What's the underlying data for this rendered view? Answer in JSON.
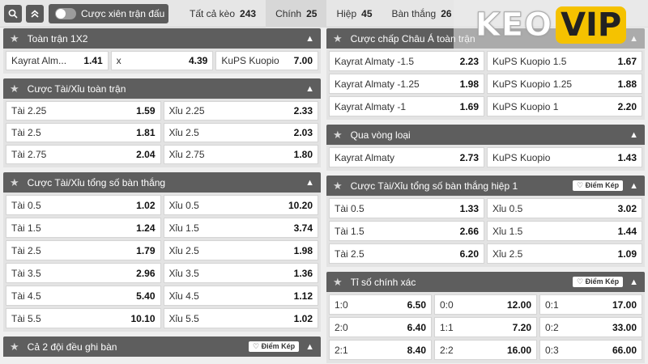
{
  "topbar": {
    "search_icon": "search-icon",
    "collapse_icon": "double-chevron-up-icon",
    "toggle_label": "Cược xiên trận đấu",
    "tabs": [
      {
        "label": "Tất cả kèo",
        "count": "243"
      },
      {
        "label": "Chính",
        "count": "25"
      },
      {
        "label": "Hiệp",
        "count": "45"
      },
      {
        "label": "Bàn thắng",
        "count": "26"
      }
    ]
  },
  "logo": {
    "part1": "KEO",
    "part2": "VIP"
  },
  "left": {
    "p1": {
      "title": "Toàn trận 1X2",
      "rows": [
        [
          [
            "Kayrat Alm...",
            "1.41"
          ],
          [
            "x",
            "4.39"
          ],
          [
            "KuPS Kuopio",
            "7.00"
          ]
        ]
      ]
    },
    "p2": {
      "title": "Cược Tài/Xỉu toàn trận",
      "rows": [
        [
          [
            "Tài 2.25",
            "1.59"
          ],
          [
            "Xỉu 2.25",
            "2.33"
          ]
        ],
        [
          [
            "Tài 2.5",
            "1.81"
          ],
          [
            "Xỉu 2.5",
            "2.03"
          ]
        ],
        [
          [
            "Tài 2.75",
            "2.04"
          ],
          [
            "Xỉu 2.75",
            "1.80"
          ]
        ]
      ]
    },
    "p3": {
      "title": "Cược Tài/Xỉu tổng số bàn thắng",
      "rows": [
        [
          [
            "Tài 0.5",
            "1.02"
          ],
          [
            "Xỉu 0.5",
            "10.20"
          ]
        ],
        [
          [
            "Tài 1.5",
            "1.24"
          ],
          [
            "Xỉu 1.5",
            "3.74"
          ]
        ],
        [
          [
            "Tài 2.5",
            "1.79"
          ],
          [
            "Xỉu 2.5",
            "1.98"
          ]
        ],
        [
          [
            "Tài 3.5",
            "2.96"
          ],
          [
            "Xỉu 3.5",
            "1.36"
          ]
        ],
        [
          [
            "Tài 4.5",
            "5.40"
          ],
          [
            "Xỉu 4.5",
            "1.12"
          ]
        ],
        [
          [
            "Tài 5.5",
            "10.10"
          ],
          [
            "Xỉu 5.5",
            "1.02"
          ]
        ]
      ]
    },
    "p4": {
      "title": "Cả 2 đội đều ghi bàn",
      "badge": "Điểm Kép"
    }
  },
  "right": {
    "p1": {
      "title": "Cược chấp Châu Á toàn trận",
      "rows": [
        [
          [
            "Kayrat Almaty -1.5",
            "2.23"
          ],
          [
            "KuPS Kuopio 1.5",
            "1.67"
          ]
        ],
        [
          [
            "Kayrat Almaty -1.25",
            "1.98"
          ],
          [
            "KuPS Kuopio 1.25",
            "1.88"
          ]
        ],
        [
          [
            "Kayrat Almaty -1",
            "1.69"
          ],
          [
            "KuPS Kuopio 1",
            "2.20"
          ]
        ]
      ]
    },
    "p2": {
      "title": "Qua vòng loại",
      "rows": [
        [
          [
            "Kayrat Almaty",
            "2.73"
          ],
          [
            "KuPS Kuopio",
            "1.43"
          ]
        ]
      ]
    },
    "p3": {
      "title": "Cược Tài/Xỉu tổng số bàn thắng hiệp 1",
      "badge": "Điểm Kép",
      "rows": [
        [
          [
            "Tài 0.5",
            "1.33"
          ],
          [
            "Xỉu 0.5",
            "3.02"
          ]
        ],
        [
          [
            "Tài 1.5",
            "2.66"
          ],
          [
            "Xỉu 1.5",
            "1.44"
          ]
        ],
        [
          [
            "Tài 2.5",
            "6.20"
          ],
          [
            "Xỉu 2.5",
            "1.09"
          ]
        ]
      ]
    },
    "p4": {
      "title": "Tỉ số chính xác",
      "badge": "Điểm Kép",
      "rows": [
        [
          [
            "1:0",
            "6.50"
          ],
          [
            "0:0",
            "12.00"
          ],
          [
            "0:1",
            "17.00"
          ]
        ],
        [
          [
            "2:0",
            "6.40"
          ],
          [
            "1:1",
            "7.20"
          ],
          [
            "0:2",
            "33.00"
          ]
        ],
        [
          [
            "2:1",
            "8.40"
          ],
          [
            "2:2",
            "16.00"
          ],
          [
            "0:3",
            "66.00"
          ]
        ]
      ]
    }
  }
}
